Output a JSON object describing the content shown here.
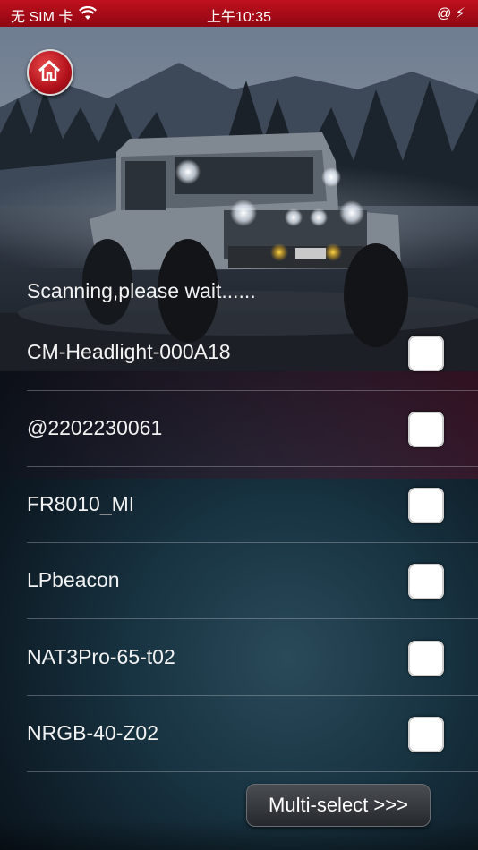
{
  "status_bar": {
    "carrier": "无 SIM 卡",
    "time": "上午10:35",
    "right": "@ ⚡"
  },
  "header": {
    "home_icon": "home-icon",
    "scan_status": "Scanning,please wait......"
  },
  "devices": [
    {
      "name": "CM-Headlight-000A18",
      "checked": false
    },
    {
      "name": "@2202230061",
      "checked": false
    },
    {
      "name": "FR8010_MI",
      "checked": false
    },
    {
      "name": "LPbeacon",
      "checked": false
    },
    {
      "name": "NAT3Pro-65-t02",
      "checked": false
    },
    {
      "name": "NRGB-40-Z02",
      "checked": false
    }
  ],
  "footer": {
    "multi_select_label": "Multi-select  >>>"
  },
  "colors": {
    "status_bar": "#b30d18",
    "checkbox": "#ffffff",
    "text": "#f2f2f2"
  }
}
